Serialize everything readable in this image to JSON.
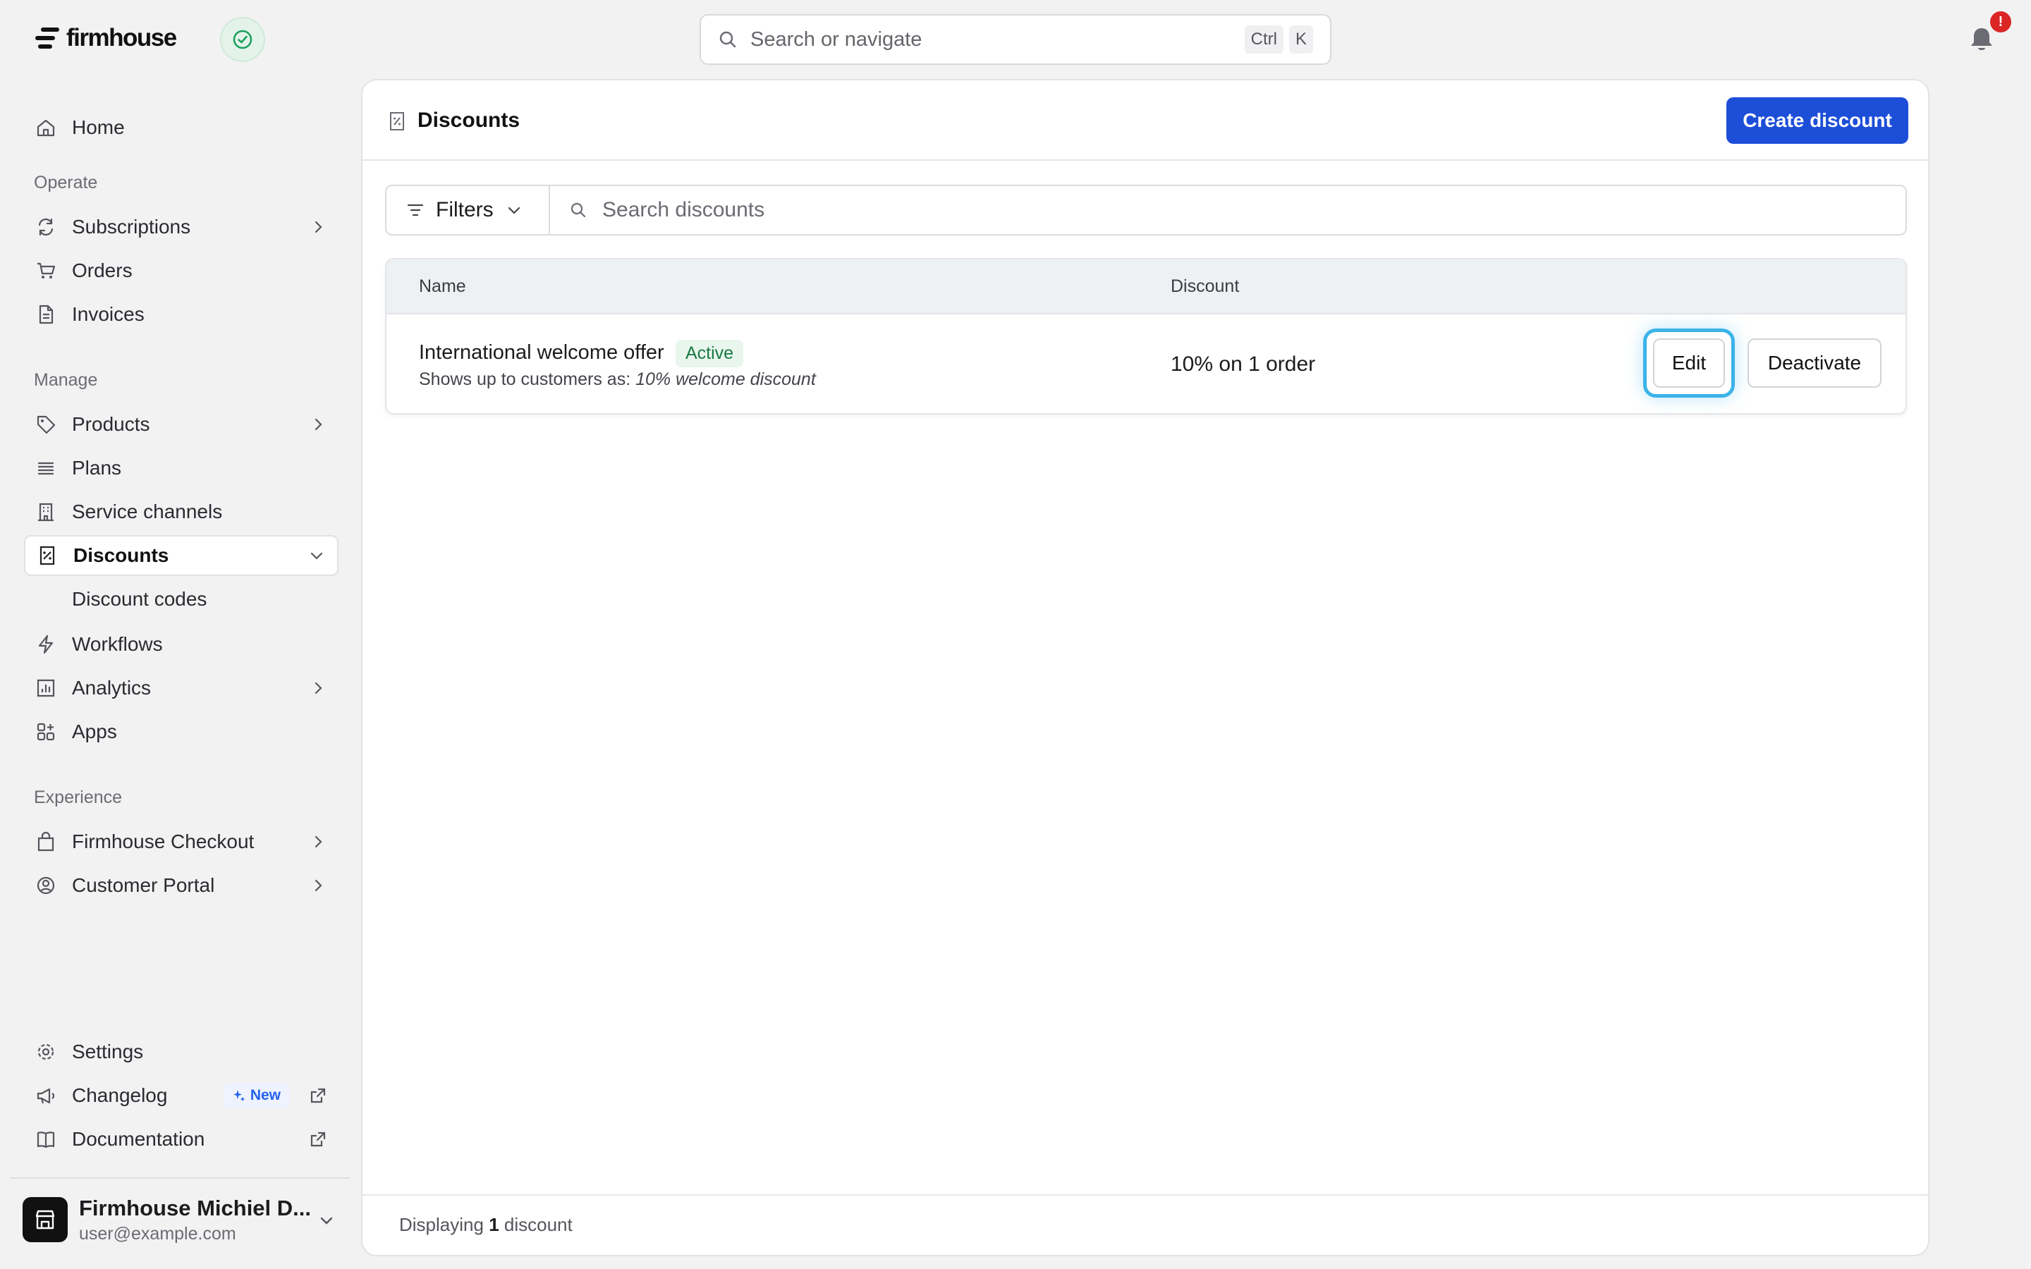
{
  "app": {
    "logo_text": "firmhouse"
  },
  "topbar": {
    "search_placeholder": "Search or navigate",
    "shortcut_keys": [
      "Ctrl",
      "K"
    ],
    "notification_count": "!"
  },
  "sidebar": {
    "home": "Home",
    "sections": {
      "operate": "Operate",
      "manage": "Manage",
      "experience": "Experience"
    },
    "operate_items": [
      {
        "label": "Subscriptions",
        "icon": "refresh-icon",
        "has_chevron": true
      },
      {
        "label": "Orders",
        "icon": "cart-icon"
      },
      {
        "label": "Invoices",
        "icon": "document-icon"
      }
    ],
    "manage_items": [
      {
        "label": "Products",
        "icon": "tag-icon",
        "has_chevron": true
      },
      {
        "label": "Plans",
        "icon": "list-icon"
      },
      {
        "label": "Service channels",
        "icon": "building-icon"
      },
      {
        "label": "Discounts",
        "icon": "discount-icon",
        "selected": true,
        "expanded": true
      },
      {
        "label": "Discount codes",
        "sub": true
      },
      {
        "label": "Workflows",
        "icon": "lightning-icon"
      },
      {
        "label": "Analytics",
        "icon": "chart-icon",
        "has_chevron": true
      },
      {
        "label": "Apps",
        "icon": "apps-icon"
      }
    ],
    "experience_items": [
      {
        "label": "Firmhouse Checkout",
        "icon": "bag-icon",
        "has_chevron": true
      },
      {
        "label": "Customer Portal",
        "icon": "user-circle-icon",
        "has_chevron": true
      }
    ],
    "footer_items": [
      {
        "label": "Settings",
        "icon": "gear-icon"
      },
      {
        "label": "Changelog",
        "icon": "megaphone-icon",
        "badge": "New",
        "external": true
      },
      {
        "label": "Documentation",
        "icon": "book-icon",
        "external": true
      }
    ],
    "org": {
      "name": "Firmhouse Michiel D...",
      "email": "user@example.com"
    }
  },
  "main": {
    "title": "Discounts",
    "create_button": "Create discount",
    "filters_label": "Filters",
    "search_placeholder": "Search discounts",
    "columns": {
      "name": "Name",
      "discount": "Discount"
    },
    "rows": [
      {
        "name": "International welcome offer",
        "status": "Active",
        "subtitle_prefix": "Shows up to customers as:",
        "subtitle_value": "10% welcome discount",
        "discount": "10% on 1 order",
        "actions": {
          "edit": "Edit",
          "deactivate": "Deactivate"
        }
      }
    ],
    "footer": {
      "prefix": "Displaying",
      "count": "1",
      "suffix": "discount"
    }
  },
  "colors": {
    "primary": "#1d4ed8",
    "focus_ring": "#3ab3e8",
    "active_badge_bg": "#e8f6ed",
    "active_badge_text": "#1a7a43",
    "notification": "#dc2626"
  }
}
